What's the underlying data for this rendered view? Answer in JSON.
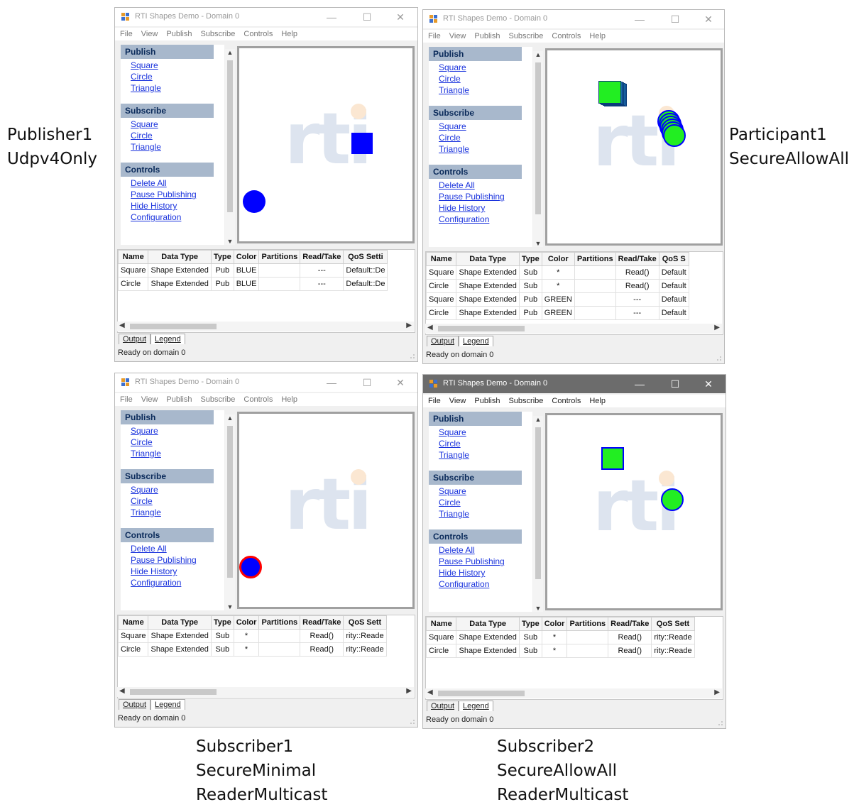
{
  "captions": {
    "publisher1": {
      "line1": "Publisher1",
      "line2": "Udpv4Only"
    },
    "participant1": {
      "line1": "Participant1",
      "line2": "SecureAllowAll"
    },
    "subscriber1": {
      "line1": "Subscriber1",
      "line2": "SecureMinimal",
      "line3": "ReaderMulticast"
    },
    "subscriber2": {
      "line1": "Subscriber2",
      "line2": "SecureAllowAll",
      "line3": "ReaderMulticast"
    }
  },
  "window": {
    "title": "RTI Shapes Demo - Domain 0",
    "min_glyph": "—",
    "max_glyph": "☐",
    "close_glyph": "✕",
    "menu": [
      "File",
      "View",
      "Publish",
      "Subscribe",
      "Controls",
      "Help"
    ],
    "publish_header": "Publish",
    "publish_links": [
      "Square",
      "Circle",
      "Triangle"
    ],
    "subscribe_header": "Subscribe",
    "subscribe_links": [
      "Square",
      "Circle",
      "Triangle"
    ],
    "controls_header": "Controls",
    "controls_links": [
      "Delete All",
      "Pause Publishing",
      "Hide History",
      "Configuration"
    ],
    "logo_text": "rti",
    "tabs": [
      "Output",
      "Legend"
    ],
    "status": "Ready on domain 0"
  },
  "tables": {
    "w1": {
      "headers": [
        "Name",
        "Data Type",
        "Type",
        "Color",
        "Partitions",
        "Read/Take",
        "QoS Setti"
      ],
      "rows": [
        [
          "Square",
          "Shape Extended",
          "Pub",
          "BLUE",
          "",
          "---",
          "Default::De"
        ],
        [
          "Circle",
          "Shape Extended",
          "Pub",
          "BLUE",
          "",
          "---",
          "Default::De"
        ]
      ]
    },
    "w2": {
      "headers": [
        "Name",
        "Data Type",
        "Type",
        "Color",
        "Partitions",
        "Read/Take",
        "QoS S"
      ],
      "rows": [
        [
          "Square",
          "Shape Extended",
          "Sub",
          "*",
          "",
          "Read()",
          "Default"
        ],
        [
          "Circle",
          "Shape Extended",
          "Sub",
          "*",
          "",
          "Read()",
          "Default"
        ],
        [
          "Square",
          "Shape Extended",
          "Pub",
          "GREEN",
          "",
          "---",
          "Default"
        ],
        [
          "Circle",
          "Shape Extended",
          "Pub",
          "GREEN",
          "",
          "---",
          "Default"
        ]
      ]
    },
    "w3": {
      "headers": [
        "Name",
        "Data Type",
        "Type",
        "Color",
        "Partitions",
        "Read/Take",
        "QoS Sett"
      ],
      "rows": [
        [
          "Square",
          "Shape Extended",
          "Sub",
          "*",
          "",
          "Read()",
          "rity::Reade"
        ],
        [
          "Circle",
          "Shape Extended",
          "Sub",
          "*",
          "",
          "Read()",
          "rity::Reade"
        ]
      ]
    },
    "w4": {
      "headers": [
        "Name",
        "Data Type",
        "Type",
        "Color",
        "Partitions",
        "Read/Take",
        "QoS Sett"
      ],
      "rows": [
        [
          "Square",
          "Shape Extended",
          "Sub",
          "*",
          "",
          "Read()",
          "rity::Reade"
        ],
        [
          "Circle",
          "Shape Extended",
          "Sub",
          "*",
          "",
          "Read()",
          "rity::Reade"
        ]
      ]
    }
  },
  "colors": {
    "blue_shape": "#0000ff",
    "green_shape": "#22ee22",
    "section_header_bg": "#a8b8cc",
    "link": "#1a33dd",
    "active_titlebar": "#6c6c6c"
  },
  "icons": [
    "rti-app-icon",
    "minimize-icon",
    "maximize-icon",
    "close-icon",
    "scroll-up-icon",
    "scroll-down-icon",
    "scroll-left-icon",
    "scroll-right-icon",
    "size-grip-icon"
  ]
}
